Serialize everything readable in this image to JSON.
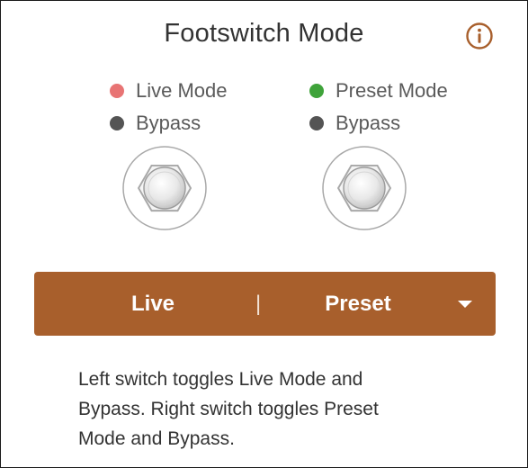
{
  "header": {
    "title": "Footswitch Mode",
    "info_icon": "info-circle-icon"
  },
  "switches": {
    "left": {
      "icon": "footswitch-icon",
      "legend": [
        {
          "label": "Live Mode",
          "color": "#e87474"
        },
        {
          "label": "Bypass",
          "color": "#545454"
        }
      ]
    },
    "right": {
      "icon": "footswitch-icon",
      "legend": [
        {
          "label": "Preset Mode",
          "color": "#3fa33a"
        },
        {
          "label": "Bypass",
          "color": "#545454"
        }
      ]
    }
  },
  "mode_selector": {
    "left_label": "Live",
    "separator": "|",
    "right_label": "Preset",
    "dropdown_icon": "caret-down-icon",
    "background_color": "#a85f2c"
  },
  "description": "Left switch toggles Live Mode and Bypass. Right switch toggles Preset Mode and Bypass.",
  "colors": {
    "accent": "#a85f2c",
    "text": "#333333",
    "muted_text": "#5a5a5a"
  }
}
